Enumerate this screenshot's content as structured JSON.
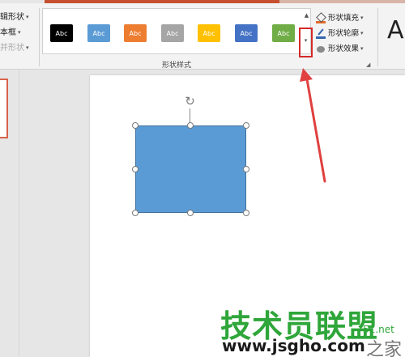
{
  "ribbon": {
    "left_group": {
      "items": [
        {
          "label": "辑形状",
          "dropdown": true
        },
        {
          "label": "本框",
          "dropdown": true
        },
        {
          "label": "并形状",
          "dropdown": true,
          "disabled": true
        }
      ]
    },
    "shape_styles": {
      "group_label": "形状样式",
      "swatches": [
        {
          "label": "Abc",
          "color": "#000000"
        },
        {
          "label": "Abc",
          "color": "#5b9bd5"
        },
        {
          "label": "Abc",
          "color": "#ed7d31"
        },
        {
          "label": "Abc",
          "color": "#a5a5a5"
        },
        {
          "label": "Abc",
          "color": "#ffc000"
        },
        {
          "label": "Abc",
          "color": "#4472c4"
        },
        {
          "label": "Abc",
          "color": "#70ad47"
        }
      ],
      "scroll_up_icon": "triangle-up-icon",
      "scroll_down_icon": "triangle-down-icon",
      "more_icon": "gallery-more-icon",
      "more_highlight_color": "#d42a2a"
    },
    "format_buttons": [
      {
        "label": "形状填充",
        "icon": "paint-bucket-icon"
      },
      {
        "label": "形状轮廓",
        "icon": "pen-outline-icon"
      },
      {
        "label": "形状效果",
        "icon": "shape-effects-icon"
      }
    ],
    "wordart_preview": "A"
  },
  "canvas": {
    "shape_color": "#5b9bd5",
    "rotate_icon": "rotate-handle-icon",
    "annotation_arrow_color": "#e0403f"
  },
  "watermark": {
    "main": "技术员联盟",
    "url": "www.jsgho.com",
    "small": "51.net",
    "home": "之家"
  }
}
